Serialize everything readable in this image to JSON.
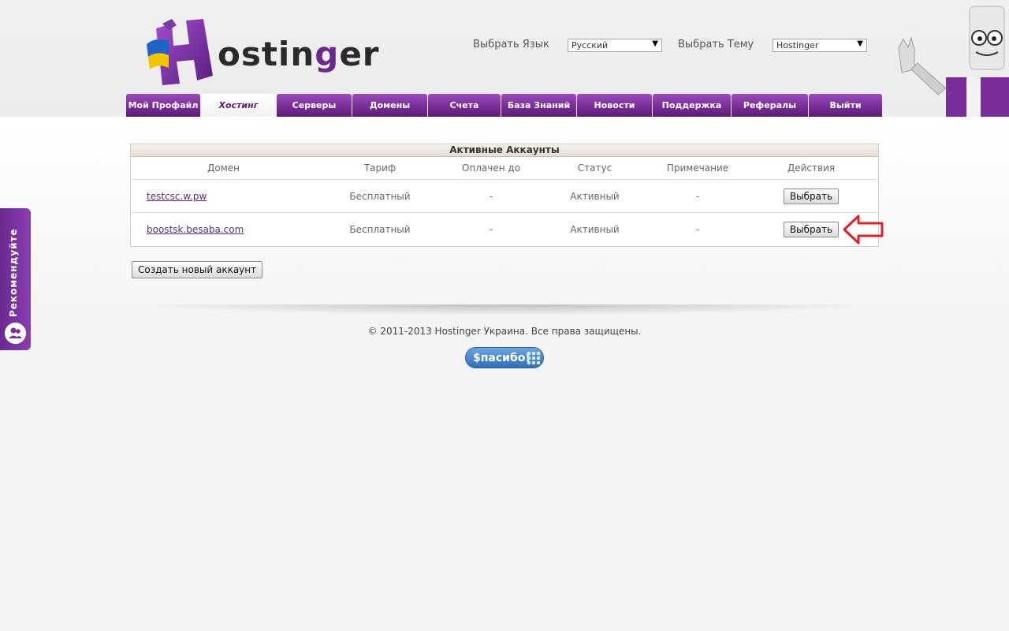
{
  "header": {
    "logo_text_start": "ostin",
    "logo_text_g": "g",
    "logo_text_end": "er",
    "lang_label": "Выбрать Язык",
    "lang_value": "Русский",
    "theme_label": "Выбрать Тему",
    "theme_value": "Hostinger"
  },
  "nav": {
    "tabs": [
      {
        "label": "Мой Профайл",
        "active": false
      },
      {
        "label": "Хостинг",
        "active": true
      },
      {
        "label": "Серверы",
        "active": false
      },
      {
        "label": "Домены",
        "active": false
      },
      {
        "label": "Счета",
        "active": false
      },
      {
        "label": "База Знаний",
        "active": false
      },
      {
        "label": "Новости",
        "active": false
      },
      {
        "label": "Поддержка",
        "active": false
      },
      {
        "label": "Рефералы",
        "active": false
      },
      {
        "label": "Выйти",
        "active": false
      }
    ]
  },
  "accounts": {
    "title": "Активные Аккаунты",
    "columns": [
      "Домен",
      "Тариф",
      "Оплачен до",
      "Статус",
      "Примечание",
      "Действия"
    ],
    "rows": [
      {
        "domain": "testcsc.w.pw",
        "plan": "Бесплатный",
        "paid_until": "-",
        "status": "Активный",
        "note": "-",
        "action": "Выбрать"
      },
      {
        "domain": "boostsk.besaba.com",
        "plan": "Бесплатный",
        "paid_until": "-",
        "status": "Активный",
        "note": "-",
        "action": "Выбрать"
      }
    ],
    "create_label": "Создать новый аккаунт"
  },
  "footer": {
    "copyright": "© 2011-2013 Hostinger Украина. Все права защищены.",
    "thanks_label": "$пасибо!"
  },
  "sidebar": {
    "recommend_label": "Рекомендуйте"
  },
  "colors": {
    "brand_purple": "#7a2e99",
    "link": "#5b2b85",
    "pointer_red": "#e0202a"
  }
}
